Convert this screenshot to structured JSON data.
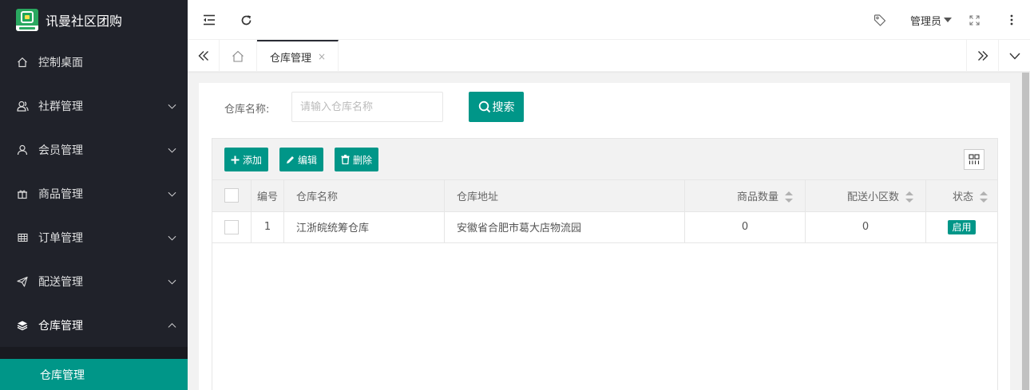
{
  "app": {
    "title": "讯曼社区团购",
    "accent": "#009688",
    "sidebar_bg": "#20222a"
  },
  "sidebar": {
    "items": [
      {
        "label": "控制桌面",
        "icon": "home-icon"
      },
      {
        "label": "社群管理",
        "icon": "users-icon"
      },
      {
        "label": "会员管理",
        "icon": "user-icon"
      },
      {
        "label": "商品管理",
        "icon": "gift-icon"
      },
      {
        "label": "订单管理",
        "icon": "grid-icon"
      },
      {
        "label": "配送管理",
        "icon": "send-icon"
      },
      {
        "label": "仓库管理",
        "icon": "layers-icon"
      }
    ],
    "sub_active": "仓库管理"
  },
  "header": {
    "user": "管理员"
  },
  "tabs": {
    "active": "仓库管理",
    "close": "×"
  },
  "search": {
    "label": "仓库名称:",
    "placeholder": "请输入仓库名称",
    "button": "搜索"
  },
  "toolbar": {
    "add": "添加",
    "edit": "编辑",
    "delete": "删除"
  },
  "table": {
    "headers": [
      "编号",
      "仓库名称",
      "仓库地址",
      "商品数量",
      "配送小区数",
      "状态"
    ],
    "rows": [
      {
        "id": "1",
        "name": "江浙皖统筹仓库",
        "address": "安徽省合肥市葛大店物流园",
        "goods": "0",
        "communities": "0",
        "status": "启用"
      }
    ]
  }
}
